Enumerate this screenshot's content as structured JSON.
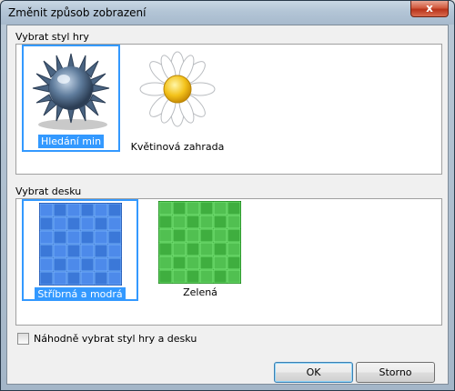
{
  "window": {
    "title": "Změnit způsob zobrazení",
    "close_glyph": "x"
  },
  "game_style": {
    "label": "Vybrat styl hry",
    "options": [
      {
        "label": "Hledání min",
        "icon": "mine-icon",
        "selected": true
      },
      {
        "label": "Květinová zahrada",
        "icon": "daisy-flower-icon",
        "selected": false
      }
    ]
  },
  "board": {
    "label": "Vybrat desku",
    "options": [
      {
        "label": "Stříbrná a modrá",
        "icon": "blue-board-icon",
        "color": "#3b78d8",
        "selected": true
      },
      {
        "label": "Zelená",
        "icon": "green-board-icon",
        "color": "#3fae3f",
        "selected": false
      }
    ]
  },
  "random_checkbox": {
    "label": "Náhodně vybrat styl hry a desku",
    "checked": false
  },
  "buttons": {
    "ok": "OK",
    "cancel": "Storno"
  },
  "colors": {
    "selection": "#3399ff",
    "blue_board": "#3b78d8",
    "green_board": "#3fae3f"
  }
}
